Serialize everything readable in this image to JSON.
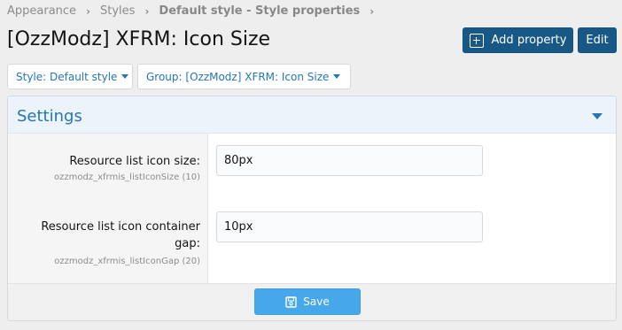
{
  "breadcrumb": {
    "items": [
      "Appearance",
      "Styles",
      "Default style - Style properties"
    ],
    "separator": "›"
  },
  "page": {
    "title": "[OzzModz] XFRM: Icon Size"
  },
  "header_buttons": {
    "add_property": "Add property",
    "edit": "Edit"
  },
  "filters": {
    "style": "Style: Default style",
    "group": "Group: [OzzModz] XFRM: Icon Size"
  },
  "block": {
    "title": "Settings",
    "rows": [
      {
        "label": "Resource list icon size:",
        "hint": "ozzmodz_xfrmis_listIconSize (10)",
        "value": "80px"
      },
      {
        "label": "Resource list icon container gap:",
        "hint": "ozzmodz_xfrmis_listIconGap (20)",
        "value": "10px"
      }
    ],
    "save_label": "Save"
  },
  "colors": {
    "accent": "#185886",
    "link": "#2577b1",
    "save_button": "#47a7eb",
    "header_bg": "#edf3fa",
    "page_bg": "#eeeeee"
  },
  "icons": {
    "add_property": "plus-square-icon",
    "save": "floppy-disk-icon",
    "dropdown": "caret-down-icon",
    "collapse": "collapse-caret-icon"
  }
}
